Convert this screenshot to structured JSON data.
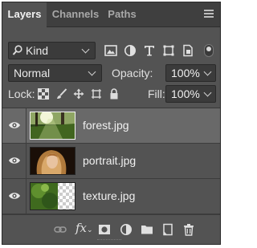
{
  "panel": {
    "tabs": [
      {
        "label": "Layers",
        "active": true
      },
      {
        "label": "Channels",
        "active": false
      },
      {
        "label": "Paths",
        "active": false
      }
    ],
    "menu_icon": "hamburger-menu-icon"
  },
  "filter": {
    "kind_label": "Kind",
    "icons": [
      "image-filter-icon",
      "adjustment-filter-icon",
      "type-filter-icon",
      "shape-filter-icon",
      "smart-object-filter-icon"
    ],
    "toggle_on": true
  },
  "blend": {
    "mode": "Normal",
    "opacity_label": "Opacity:",
    "opacity_value": "100%"
  },
  "lock": {
    "label": "Lock:",
    "icons": [
      "lock-transparent-pixels-icon",
      "lock-image-pixels-icon",
      "lock-position-icon",
      "lock-artboard-icon",
      "lock-all-icon"
    ],
    "fill_label": "Fill:",
    "fill_value": "100%"
  },
  "layers": [
    {
      "name": "forest.jpg",
      "selected": true,
      "visible": true
    },
    {
      "name": "portrait.jpg",
      "selected": false,
      "visible": true
    },
    {
      "name": "texture.jpg",
      "selected": false,
      "visible": true
    }
  ],
  "bottom_icons": [
    "link-layers-icon",
    "fx-icon",
    "add-mask-icon",
    "adjustment-layer-icon",
    "new-group-icon",
    "new-layer-icon",
    "delete-layer-icon"
  ],
  "bottom_fx_label": "fx",
  "colors": {
    "panel_bg": "#535353",
    "tab_bar_bg": "#3f3f3f",
    "selected_row": "#696969",
    "field_bg": "#3b3b3b",
    "text": "#f0f0f0"
  }
}
